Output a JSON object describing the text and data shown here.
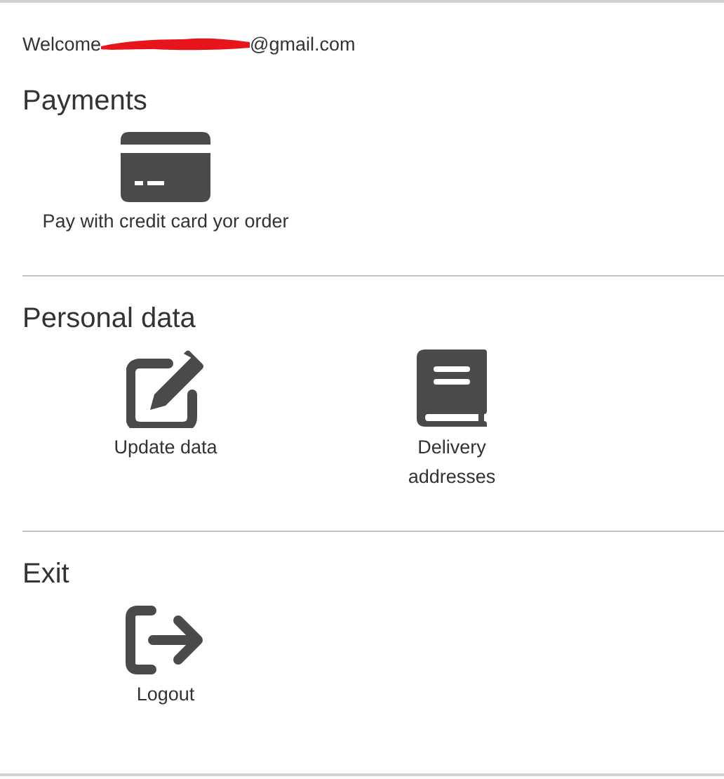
{
  "welcome": {
    "label": "Welcome",
    "email_suffix": "@gmail.com",
    "redacted": true
  },
  "sections": [
    {
      "title": "Payments",
      "items": [
        {
          "label": "Pay with credit card yor order",
          "kind": "card"
        }
      ]
    },
    {
      "title": "Personal data",
      "items": [
        {
          "label": "Update data",
          "kind": "edit"
        },
        {
          "label": "Delivery addresses",
          "kind": "book"
        }
      ]
    },
    {
      "title": "Exit",
      "items": [
        {
          "label": "Logout",
          "kind": "logout"
        }
      ]
    }
  ]
}
